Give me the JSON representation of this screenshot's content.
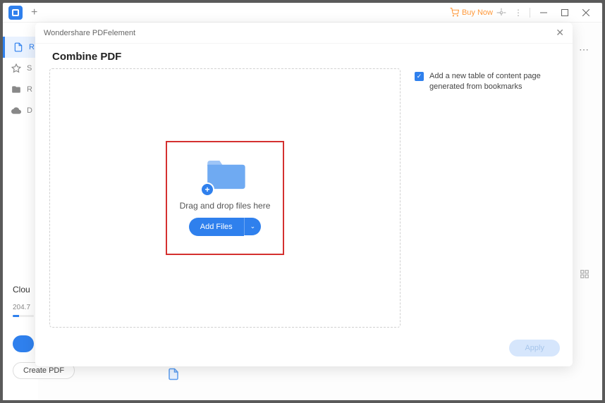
{
  "titlebar": {
    "buy_now": "Buy Now"
  },
  "sidebar": {
    "items": [
      {
        "label": "R"
      },
      {
        "label": "S"
      },
      {
        "label": "R"
      },
      {
        "label": "D"
      }
    ]
  },
  "background": {
    "cloud_label": "Clou",
    "size": "204.7"
  },
  "create_pdf_btn": "Create PDF",
  "modal": {
    "header": "Wondershare PDFelement",
    "title": "Combine PDF",
    "drop_text": "Drag and drop files here",
    "add_files": "Add Files",
    "checkbox_text": "Add a new table of content page generated from bookmarks",
    "apply": "Apply"
  }
}
